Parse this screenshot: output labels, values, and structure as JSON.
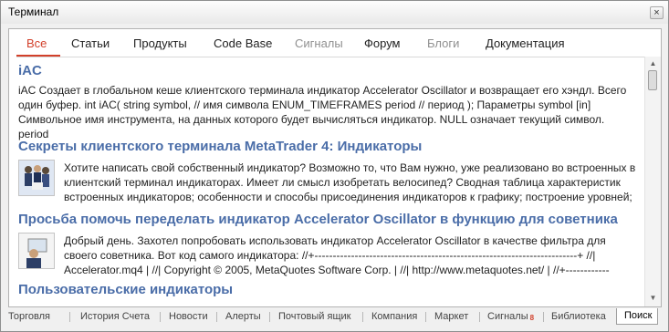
{
  "window": {
    "title": "Терминал",
    "close_glyph": "×"
  },
  "tabs": [
    {
      "label": "Все"
    },
    {
      "label": "Статьи"
    },
    {
      "label": "Продукты"
    },
    {
      "label": "Code Base"
    },
    {
      "label": "Сигналы"
    },
    {
      "label": "Форум"
    },
    {
      "label": "Блоги"
    },
    {
      "label": "Документация"
    }
  ],
  "results": [
    {
      "title": "iAC",
      "snippet": "iAC Создает в глобальном кеше клиентского терминала индикатор Accelerator Oscillator и возвращает его хэндл. Всего один буфер. int  iAC( string  symbol,  // имя символа ENUM_TIMEFRAMES  period  // период ); Параметры symbol [in] Символьное имя инструмента, на данных которого будет вычисляться индикатор. NULL означает текущий символ. period"
    },
    {
      "title": "Секреты клиентского терминала MetaTrader 4: Индикаторы",
      "snippet": "Хотите написать свой собственный индикатор? Возможно то, что Вам нужно, уже реализовано во встроенных в клиентский терминал индикаторах. Имеет ли смысл изобретать велосипед? Сводная таблица характеристик встроенных индикаторов; особенности и способы присоединения индикаторов к графику; построение уровней;"
    },
    {
      "title": "Просьба помочь переделать индикатор Accelerator Oscillator в функцию для советника",
      "snippet": "Добрый день. Захотел попробовать использовать индикатор Accelerator Oscillator в качестве фильтра для своего советника. Вот код самого индикатора: //+------------------------------------------------------------------------+ //| Accelerator.mq4 | //| Copyright © 2005, MetaQuotes Software Corp. | //| http://www.metaquotes.net/ | //+------------"
    },
    {
      "title": "Пользовательские индикаторы"
    }
  ],
  "bottom_tabs": [
    {
      "label": "Торговля"
    },
    {
      "label": "История Счета"
    },
    {
      "label": "Новости"
    },
    {
      "label": "Алерты"
    },
    {
      "label": "Почтовый ящик"
    },
    {
      "label": "Компания"
    },
    {
      "label": "Маркет"
    },
    {
      "label": "Сигналы",
      "badge": "8"
    },
    {
      "label": "Библиотека"
    },
    {
      "label": "Поиск"
    }
  ],
  "icons": {
    "scroll_up": "▲",
    "scroll_down": "▼"
  },
  "colors": {
    "accent": "#d2402b",
    "link": "#4a6da8"
  }
}
